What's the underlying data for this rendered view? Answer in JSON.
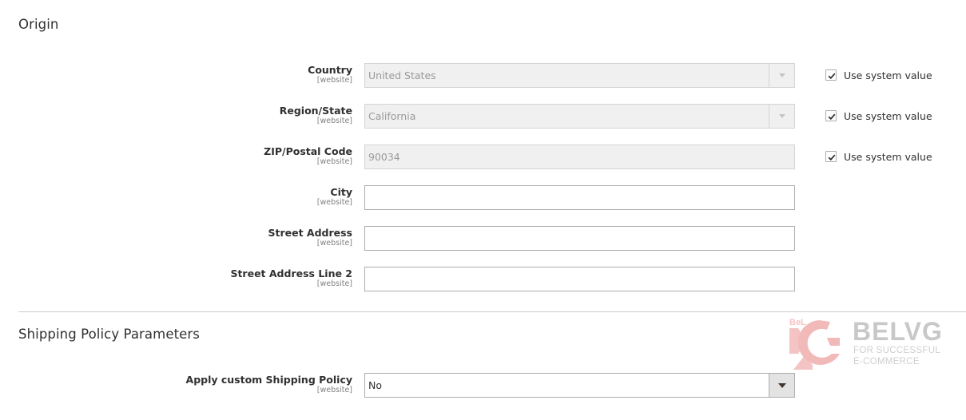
{
  "sections": {
    "origin": {
      "title": "Origin",
      "fields": [
        {
          "label": "Country",
          "scope": "[website]",
          "value": "United States",
          "type": "select",
          "disabled": true,
          "use_system_value": true
        },
        {
          "label": "Region/State",
          "scope": "[website]",
          "value": "California",
          "type": "select",
          "disabled": true,
          "use_system_value": true
        },
        {
          "label": "ZIP/Postal Code",
          "scope": "[website]",
          "value": "90034",
          "type": "text",
          "disabled": true,
          "use_system_value": true
        },
        {
          "label": "City",
          "scope": "[website]",
          "value": "",
          "type": "text",
          "disabled": false
        },
        {
          "label": "Street Address",
          "scope": "[website]",
          "value": "",
          "type": "text",
          "disabled": false
        },
        {
          "label": "Street Address Line 2",
          "scope": "[website]",
          "value": "",
          "type": "text",
          "disabled": false
        }
      ],
      "use_system_value_label": "Use system value"
    },
    "shipping_policy": {
      "title": "Shipping Policy Parameters",
      "fields": [
        {
          "label": "Apply custom Shipping Policy",
          "scope": "[website]",
          "value": "No",
          "type": "select"
        }
      ]
    }
  },
  "watermark": {
    "brand": "BELVG",
    "tagline_1": "FOR SUCCESSFUL",
    "tagline_2": "E-COMMERCE",
    "mark_text": "BeL",
    "color": "#f2b9b9"
  }
}
